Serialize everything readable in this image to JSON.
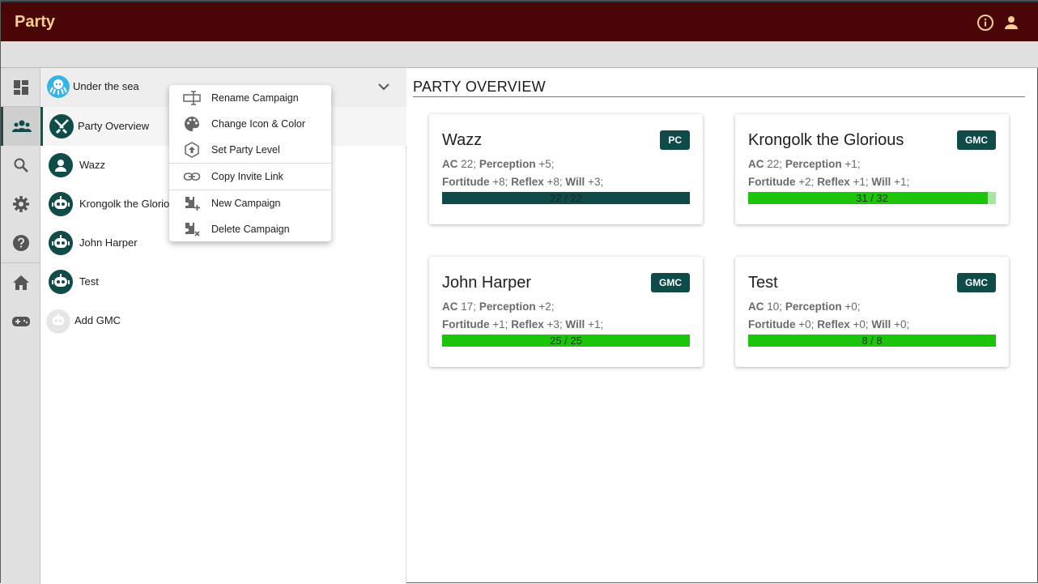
{
  "app": {
    "title": "Party"
  },
  "campaign": {
    "name": "Under the sea"
  },
  "sidebar": {
    "items": [
      {
        "label": "Party Overview",
        "icon": "swords-icon"
      },
      {
        "label": "Wazz",
        "icon": "person-icon"
      },
      {
        "label": "Krongolk the Glorio",
        "icon": "robot-icon"
      },
      {
        "label": "John Harper",
        "icon": "robot-icon"
      },
      {
        "label": "Test",
        "icon": "robot-icon"
      },
      {
        "label": "Add GMC",
        "icon": "robot-icon"
      }
    ]
  },
  "rail": {
    "items": [
      "dashboard-icon",
      "party-icon",
      "search-icon",
      "settings-icon",
      "help-icon",
      "home-icon",
      "gamepad-icon"
    ]
  },
  "menu": {
    "items": [
      {
        "label": "Rename Campaign",
        "icon": "rename-icon"
      },
      {
        "label": "Change Icon & Color",
        "icon": "palette-icon"
      },
      {
        "label": "Set Party Level",
        "icon": "level-up-icon"
      },
      {
        "label": "Copy Invite Link",
        "icon": "link-icon"
      },
      {
        "label": "New Campaign",
        "icon": "puzzle-add-icon"
      },
      {
        "label": "Delete Campaign",
        "icon": "puzzle-remove-icon"
      }
    ]
  },
  "main": {
    "title": "PARTY OVERVIEW",
    "cards": [
      {
        "name": "Wazz",
        "badge": "PC",
        "ac_label": "AC",
        "ac": "22",
        "perception_label": "Perception",
        "perception": "+5",
        "fortitude_label": "Fortitude",
        "fortitude": "+8",
        "reflex_label": "Reflex",
        "reflex": "+8",
        "will_label": "Will",
        "will": "+3",
        "hp_text": "22 / 22",
        "hp_current": 22,
        "hp_max": 22,
        "hp_color": "#0f4b48"
      },
      {
        "name": "Krongolk the Glorious",
        "badge": "GMC",
        "ac_label": "AC",
        "ac": "22",
        "perception_label": "Perception",
        "perception": "+1",
        "fortitude_label": "Fortitude",
        "fortitude": "+2",
        "reflex_label": "Reflex",
        "reflex": "+1",
        "will_label": "Will",
        "will": "+1",
        "hp_text": "31 / 32",
        "hp_current": 31,
        "hp_max": 32,
        "hp_color": "#1dc40a"
      },
      {
        "name": "John Harper",
        "badge": "GMC",
        "ac_label": "AC",
        "ac": "17",
        "perception_label": "Perception",
        "perception": "+2",
        "fortitude_label": "Fortitude",
        "fortitude": "+1",
        "reflex_label": "Reflex",
        "reflex": "+3",
        "will_label": "Will",
        "will": "+1",
        "hp_text": "25 / 25",
        "hp_current": 25,
        "hp_max": 25,
        "hp_color": "#1dc40a"
      },
      {
        "name": "Test",
        "badge": "GMC",
        "ac_label": "AC",
        "ac": "10",
        "perception_label": "Perception",
        "perception": "+0",
        "fortitude_label": "Fortitude",
        "fortitude": "+0",
        "reflex_label": "Reflex",
        "reflex": "+0",
        "will_label": "Will",
        "will": "+0",
        "hp_text": "8 / 8",
        "hp_current": 8,
        "hp_max": 8,
        "hp_color": "#1dc40a"
      }
    ]
  },
  "colors": {
    "appbar": "#4a0507",
    "accent": "#0f4b48",
    "title_text": "#f6d08c",
    "hp_green": "#1dc40a"
  }
}
